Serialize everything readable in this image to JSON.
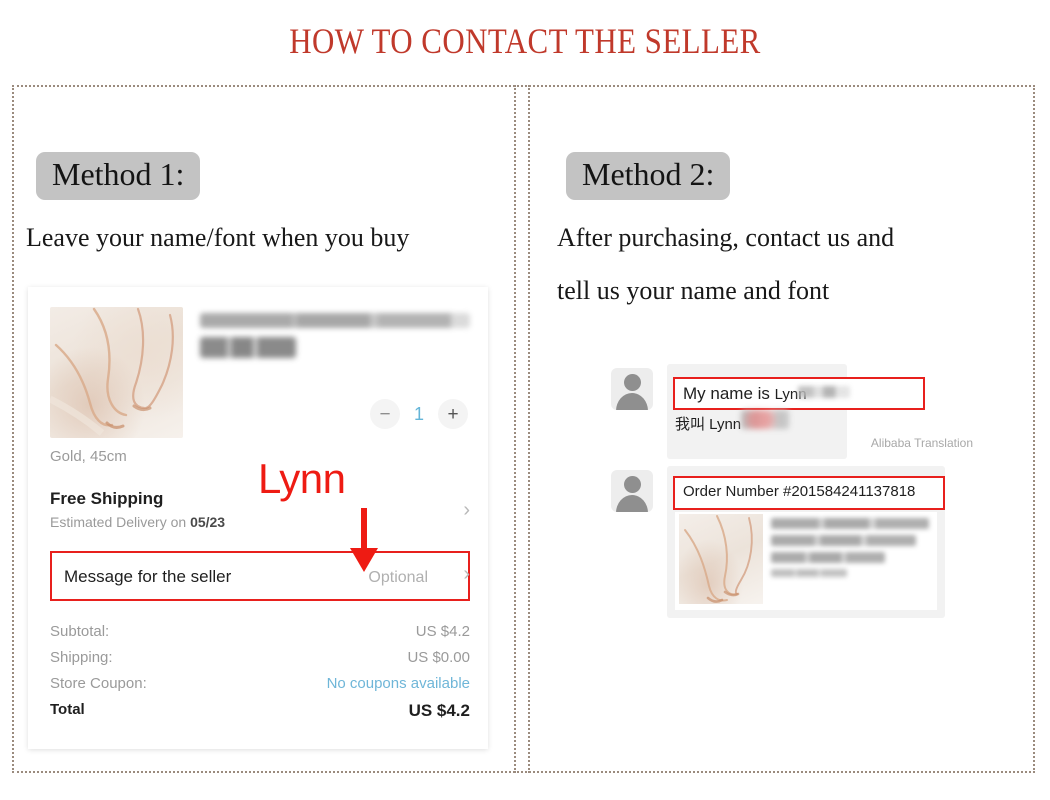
{
  "title": "HOW TO CONTACT THE SELLER",
  "colors": {
    "title_red": "#c0392b",
    "highlight_red": "#e8201d",
    "badge_gray": "#c3c3c3",
    "link_blue": "#6fb6d8",
    "frame_dotted": "#9b8b7e"
  },
  "method1": {
    "badge": "Method 1:",
    "instruction": "Leave your name/font when you buy",
    "screenshot": {
      "product_title_blurred": "Personalized Name Necklace, Cu...",
      "product_price_blurred": "US $4.2",
      "quantity": {
        "minus": "−",
        "value": "1",
        "plus": "+"
      },
      "variant": "Gold, 45cm",
      "shipping": {
        "title": "Free Shipping",
        "estimated_prefix": "Estimated Delivery on ",
        "estimated_date": "05/23",
        "chevron": "›"
      },
      "message_row": {
        "label": "Message for the seller",
        "value": "Optional",
        "chevron": "›"
      },
      "totals": [
        {
          "label": "Subtotal:",
          "value": "US $4.2",
          "style": "normal"
        },
        {
          "label": "Shipping:",
          "value": "US $0.00",
          "style": "normal"
        },
        {
          "label": "Store Coupon:",
          "value": "No coupons available",
          "style": "link"
        },
        {
          "label": "Total",
          "value": "US $4.2",
          "style": "total"
        }
      ]
    },
    "annotation": {
      "text": "Lynn",
      "arrow": "down-arrow"
    }
  },
  "method2": {
    "badge": "Method 2:",
    "instruction_line1": "After purchasing, contact us and",
    "instruction_line2": "tell us your name and font",
    "chat": [
      {
        "avatar": "user-avatar",
        "highlighted_text_main": "My name is ",
        "highlighted_text_name": "Lynn",
        "translated_text": "我叫  Lynn",
        "translation_label": "Alibaba Translation"
      },
      {
        "avatar": "user-avatar",
        "highlighted_text_main": "Order Number #201584241137818",
        "product_card_blurred_lines": [
          "Personalized Old English Fo",
          "nt Name Necklace & Pen...",
          "Payment processing",
          "for New"
        ]
      }
    ]
  }
}
